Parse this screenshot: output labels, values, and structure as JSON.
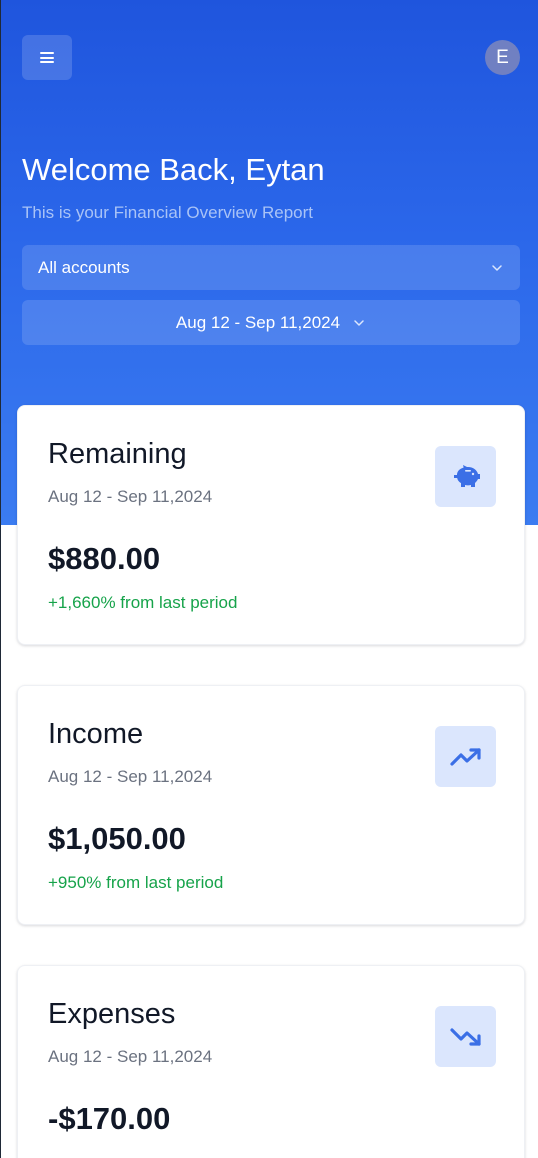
{
  "header": {
    "menu_icon": "hamburger-menu-icon",
    "avatar_initial": "E",
    "welcome": "Welcome Back, Eytan",
    "subtitle": "This is your Financial Overview Report"
  },
  "filters": {
    "account_select": "All accounts",
    "date_range": "Aug 12 - Sep 11,2024"
  },
  "colors": {
    "hero_top": "#1f55dd",
    "hero_bottom": "#3b7cf1",
    "positive": "#16a34a",
    "icon_bg": "#dbe6fd",
    "icon_fg": "#3b6fe6"
  },
  "cards": [
    {
      "title": "Remaining",
      "date": "Aug 12 - Sep 11,2024",
      "amount": "$880.00",
      "change": "+1,660% from last period",
      "icon": "piggy-bank-icon"
    },
    {
      "title": "Income",
      "date": "Aug 12 - Sep 11,2024",
      "amount": "$1,050.00",
      "change": "+950% from last period",
      "icon": "trending-up-icon"
    },
    {
      "title": "Expenses",
      "date": "Aug 12 - Sep 11,2024",
      "amount": "-$170.00",
      "change": "",
      "icon": "trending-down-icon"
    }
  ]
}
